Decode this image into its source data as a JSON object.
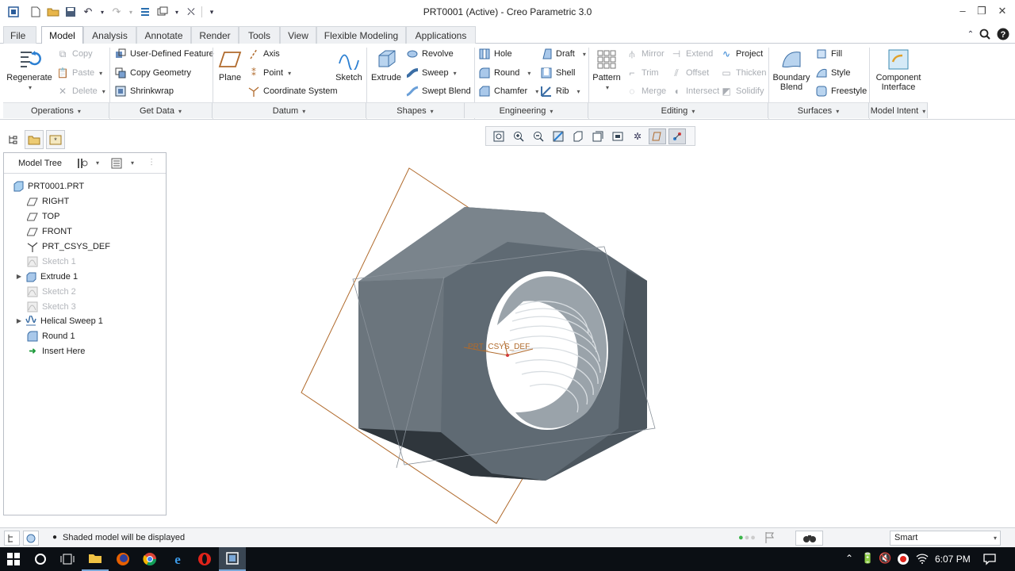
{
  "window": {
    "title": "PRT0001 (Active) - Creo Parametric 3.0"
  },
  "menu": {
    "file": "File",
    "tabs": [
      "Model",
      "Analysis",
      "Annotate",
      "Render",
      "Tools",
      "View",
      "Flexible Modeling",
      "Applications"
    ]
  },
  "ribbon": {
    "operations": {
      "regenerate": "Regenerate",
      "copy": "Copy",
      "paste": "Paste",
      "delete": "Delete",
      "footer": "Operations"
    },
    "getdata": {
      "udf": "User-Defined Feature",
      "copy_geometry": "Copy Geometry",
      "shrinkwrap": "Shrinkwrap",
      "footer": "Get Data"
    },
    "datum": {
      "plane": "Plane",
      "axis": "Axis",
      "point": "Point",
      "csys": "Coordinate System",
      "sketch": "Sketch",
      "footer": "Datum"
    },
    "shapes": {
      "extrude": "Extrude",
      "revolve": "Revolve",
      "sweep": "Sweep",
      "swept_blend": "Swept Blend",
      "footer": "Shapes"
    },
    "engineering": {
      "hole": "Hole",
      "round": "Round",
      "chamfer": "Chamfer",
      "draft": "Draft",
      "shell": "Shell",
      "rib": "Rib",
      "footer": "Engineering"
    },
    "editing": {
      "pattern": "Pattern",
      "mirror": "Mirror",
      "trim": "Trim",
      "merge": "Merge",
      "extend": "Extend",
      "offset": "Offset",
      "intersect": "Intersect",
      "project": "Project",
      "thicken": "Thicken",
      "solidify": "Solidify",
      "footer": "Editing"
    },
    "surfaces": {
      "boundary_blend_1": "Boundary",
      "boundary_blend_2": "Blend",
      "fill": "Fill",
      "style": "Style",
      "freestyle": "Freestyle",
      "footer": "Surfaces"
    },
    "model_intent": {
      "component_1": "Component",
      "component_2": "Interface",
      "footer": "Model Intent"
    }
  },
  "model_tree": {
    "header": "Model Tree",
    "items": [
      {
        "label": "PRT0001.PRT"
      },
      {
        "label": "RIGHT"
      },
      {
        "label": "TOP"
      },
      {
        "label": "FRONT"
      },
      {
        "label": "PRT_CSYS_DEF"
      },
      {
        "label": "Sketch 1"
      },
      {
        "label": "Extrude 1"
      },
      {
        "label": "Sketch 2"
      },
      {
        "label": "Sketch 3"
      },
      {
        "label": "Helical Sweep 1"
      },
      {
        "label": "Round 1"
      },
      {
        "label": "Insert Here"
      }
    ]
  },
  "viewport": {
    "csys_label": "PRT_CSYS_DEF"
  },
  "status": {
    "message": "Shaded model will be displayed",
    "filter": "Smart"
  },
  "taskbar": {
    "time": "6:07 PM"
  },
  "colors": {
    "accent": "#1a73c7",
    "model": "#6d7780",
    "datum": "#b06a2c"
  }
}
